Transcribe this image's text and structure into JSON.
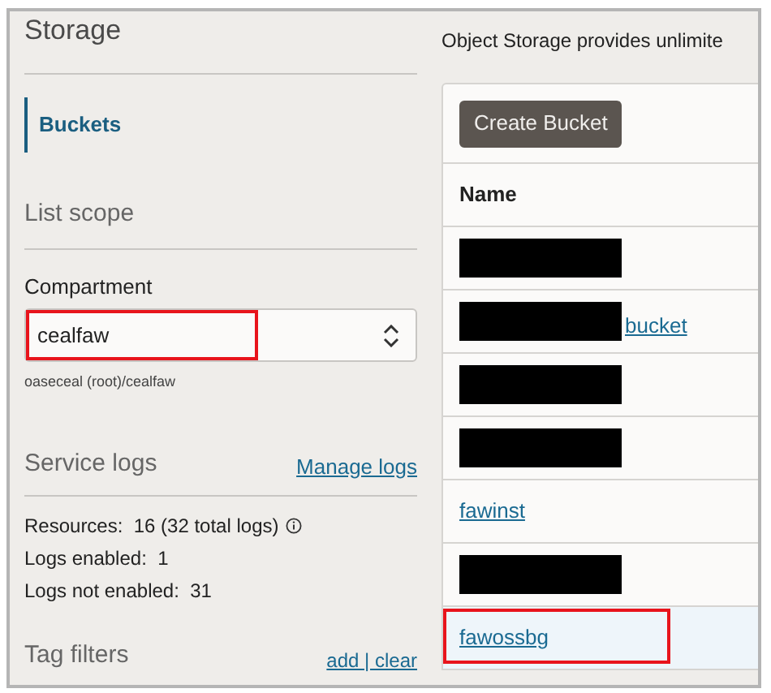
{
  "sidebar": {
    "title": "Storage",
    "nav": [
      {
        "label": "Buckets",
        "selected": true
      }
    ],
    "list_scope": {
      "heading": "List scope",
      "compartment_label": "Compartment",
      "compartment": {
        "value": "cealfaw",
        "annotated": true
      },
      "path": "oaseceal (root)/cealfaw"
    },
    "service_logs": {
      "heading": "Service logs",
      "link": "Manage logs",
      "stats": [
        {
          "text": "Resources:  16 (32 total logs)",
          "info": true
        },
        {
          "text": "Logs enabled:  1",
          "info": false
        },
        {
          "text": "Logs not enabled:  31",
          "info": false
        }
      ]
    },
    "tag_filters": {
      "heading": "Tag filters",
      "links": "add | clear"
    }
  },
  "main": {
    "intro": "Object Storage provides unlimite",
    "create_button": "Create Bucket",
    "table": {
      "columns": [
        "Name"
      ],
      "rows": [
        {
          "kind": "redacted",
          "highlighted": false,
          "annotated": false
        },
        {
          "kind": "partly_redacted",
          "name": "bucket",
          "highlighted": false,
          "annotated": false
        },
        {
          "kind": "redacted",
          "highlighted": false,
          "annotated": false
        },
        {
          "kind": "redacted",
          "highlighted": false,
          "annotated": false
        },
        {
          "kind": "link",
          "name": "fawinst",
          "highlighted": false,
          "annotated": false
        },
        {
          "kind": "redacted",
          "highlighted": false,
          "annotated": false
        },
        {
          "kind": "link",
          "name": "fawossbg",
          "highlighted": true,
          "annotated": true
        }
      ]
    }
  }
}
